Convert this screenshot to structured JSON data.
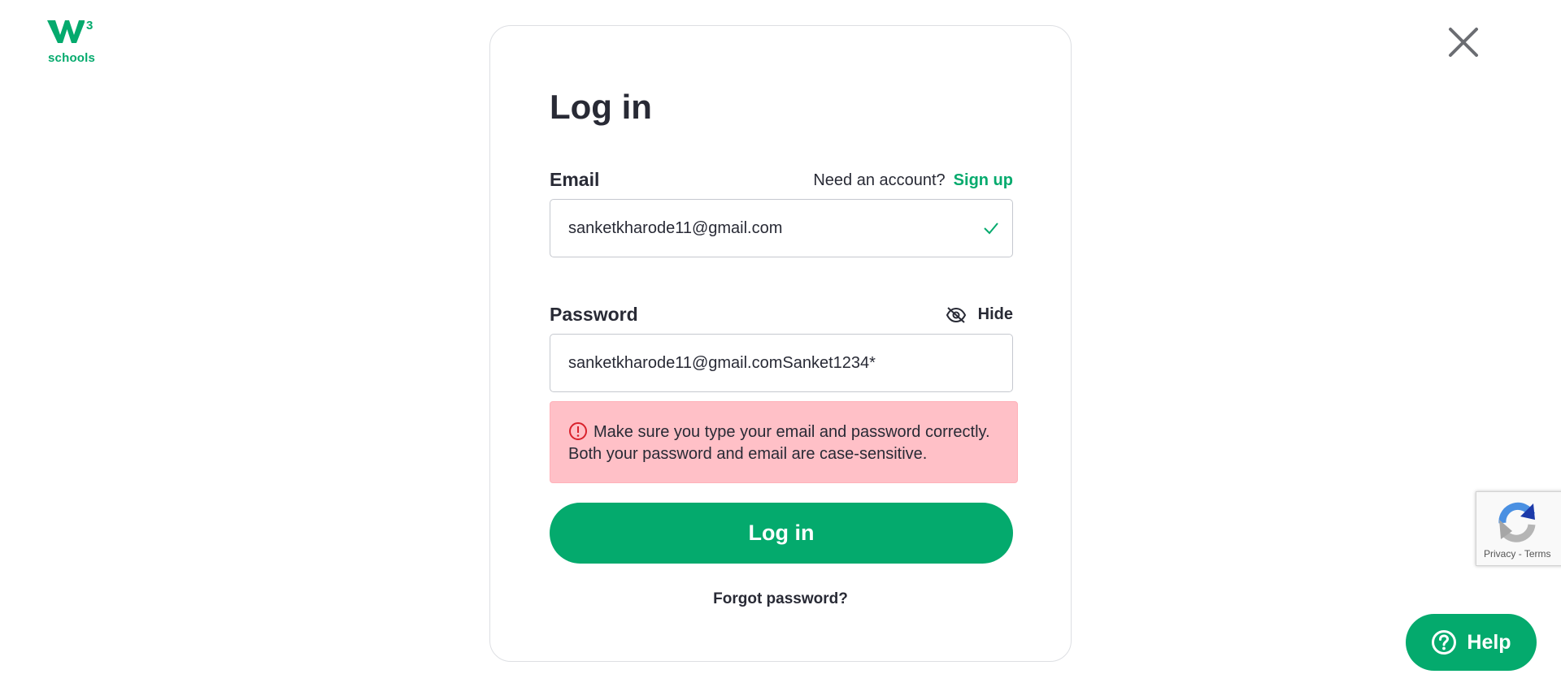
{
  "logo": {
    "superscript": "3",
    "text": "schools",
    "icon": "w3schools-logo"
  },
  "close": {
    "icon": "close-icon"
  },
  "form": {
    "title": "Log in",
    "email_label": "Email",
    "need_account": "Need an account?",
    "signup": "Sign up",
    "email_value": "sanketkharode11@gmail.com",
    "email_valid_icon": "checkmark-icon",
    "password_label": "Password",
    "hide_label": "Hide",
    "hide_icon": "eye-slash-icon",
    "password_value": "sanketkharode11@gmail.comSanket1234*",
    "error_line1": "Make sure you type your email and password correctly.",
    "error_line2": "Both your password and email are case-sensitive.",
    "error_icon": "alert-circle-icon",
    "submit_label": "Log in",
    "forgot_label": "Forgot password?"
  },
  "recaptcha": {
    "privacy": "Privacy",
    "separator": "-",
    "terms": "Terms"
  },
  "help": {
    "label": "Help",
    "icon": "question-circle-icon"
  },
  "colors": {
    "brand": "#04aa6d",
    "text": "#282a35",
    "error_bg": "#ffc0c7",
    "error_icon": "#d9212c"
  }
}
